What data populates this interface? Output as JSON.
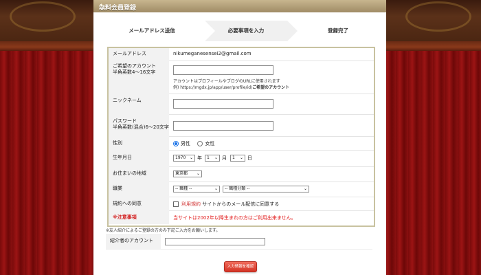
{
  "title": "無料会員登録",
  "steps": [
    "メールアドレス送信",
    "必要事項を入力",
    "登録完了"
  ],
  "form": {
    "email": {
      "label": "メールアドレス",
      "value": "nikumeganesensei2@gmail.com"
    },
    "account": {
      "label_line1": "ご希望のアカウント",
      "label_line2": "半角英数4～16文字",
      "value": "",
      "note_line1": "アカウントはプロフィールやブログのURLに使用されます",
      "note_line2_prefix": "例) https://mgdx.jp/app/user/profile/id/",
      "note_line2_bold": "ご希望のアカウント"
    },
    "nickname": {
      "label": "ニックネーム",
      "value": ""
    },
    "password": {
      "label_line1": "パスワード",
      "label_line2": "半角英数(混合)6～20文字",
      "value": ""
    },
    "gender": {
      "label": "性別",
      "options": [
        "男性",
        "女性"
      ],
      "selected": "男性"
    },
    "birthdate": {
      "label": "生年月日",
      "year": "1970",
      "month": "1",
      "day": "1",
      "year_unit": "年",
      "month_unit": "月",
      "day_unit": "日"
    },
    "region": {
      "label": "お住まいの地域",
      "value": "東京都"
    },
    "occupation": {
      "label": "職業",
      "value1": "-- 職種 --",
      "value2": "-- 職種分類 --"
    },
    "agreement": {
      "label": "規約への同意",
      "link_text": "利用規約",
      "text": "サイトからのメール配信に同意する"
    },
    "caution": {
      "label": "※注意事項",
      "text": "当サイトは2002年以降生まれの方はご利用出来ません。"
    }
  },
  "below_note": "※友人紹介によるご登録の方のみ下記ご入力をお願いします。",
  "referrer": {
    "label": "紹介者のアカウント",
    "value": ""
  },
  "submit_label": "入力情報を確認",
  "colors": {
    "warn": "#e21b1b",
    "submit": "#d43426",
    "frame": "#c8c2a0"
  }
}
